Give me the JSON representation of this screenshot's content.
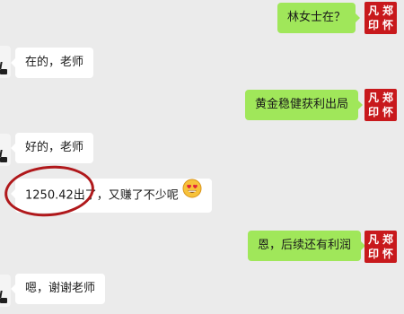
{
  "teacher_avatar_text": [
    "凡",
    "郑",
    "印",
    "怀"
  ],
  "messages": [
    {
      "side": "right",
      "text": "林女士在？"
    },
    {
      "side": "left",
      "text": "在的，老师"
    },
    {
      "side": "right",
      "text": "黄金稳健获利出局"
    },
    {
      "side": "left",
      "text": "好的，老师"
    },
    {
      "side": "left",
      "text": "1250.42出了，又赚了不少呢"
    },
    {
      "side": "right",
      "text": "恩，后续还有利润"
    },
    {
      "side": "left",
      "text": "嗯，谢谢老师"
    }
  ],
  "colors": {
    "background": "#ebebeb",
    "sent_bubble": "#a0e75a",
    "received_bubble": "#ffffff",
    "seal_red": "#c8191c",
    "annotation_red": "#b0181b"
  },
  "icons": {
    "emoji": "heart-eyes-emoji",
    "teacher_avatar": "red-seal-avatar",
    "client_avatar": "dark-glyph-avatar"
  }
}
